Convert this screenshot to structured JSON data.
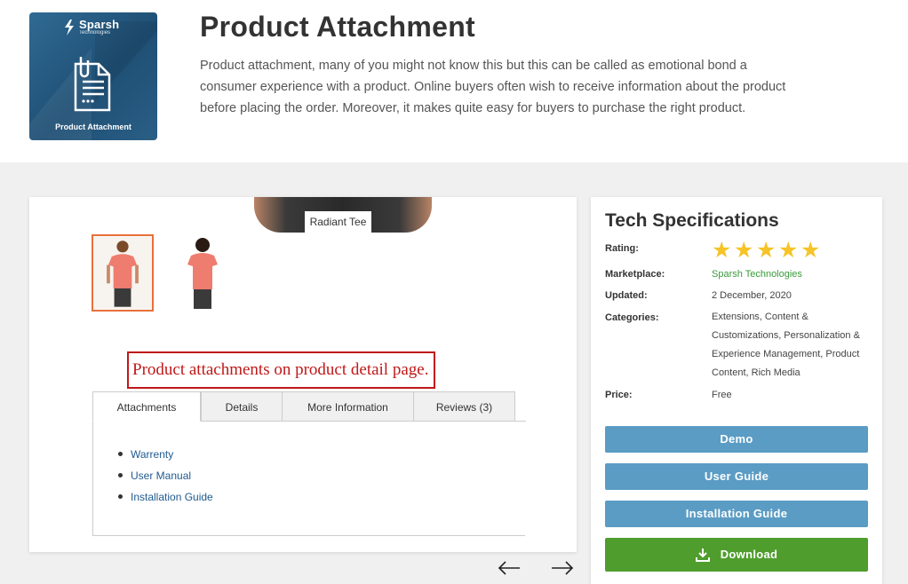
{
  "header": {
    "logo": {
      "brand_name": "Sparsh",
      "brand_sub": "Technologies",
      "caption": "Product Attachment"
    },
    "title": "Product Attachment",
    "description": "Product attachment, many of you might not know this but this can be called as emotional bond a consumer experience with a product. Online buyers often wish to receive information about the product before placing the order. Moreover, it makes quite easy for buyers to purchase the right product."
  },
  "screenshot": {
    "hero_label": "Radiant Tee",
    "callout": "Product attachments on product detail page.",
    "tabs": [
      {
        "label": "Attachments",
        "active": true
      },
      {
        "label": "Details",
        "active": false
      },
      {
        "label": "More Information",
        "active": false
      },
      {
        "label": "Reviews (3)",
        "active": false
      }
    ],
    "attachments": [
      "Warrenty",
      "User Manual",
      "Installation Guide"
    ]
  },
  "carousel": {
    "prev_icon": "arrow-left-icon",
    "next_icon": "arrow-right-icon"
  },
  "specs": {
    "title": "Tech Specifications",
    "rating_label": "Rating:",
    "rating": 5,
    "rating_max": 5,
    "marketplace_label": "Marketplace:",
    "marketplace": "Sparsh Technologies",
    "updated_label": "Updated:",
    "updated": "2 December, 2020",
    "categories_label": "Categories:",
    "categories": "Extensions, Content & Customizations, Personalization & Experience Management, Product Content, Rich Media",
    "price_label": "Price:",
    "price": "Free"
  },
  "buttons": {
    "demo": "Demo",
    "user_guide": "User Guide",
    "installation_guide": "Installation Guide",
    "download": "Download"
  },
  "colors": {
    "button_blue": "#5b9cc4",
    "download_green": "#4f9d2d",
    "link_green": "#3a9a3a",
    "star_yellow": "#f6c428",
    "callout_red": "#c01818"
  }
}
